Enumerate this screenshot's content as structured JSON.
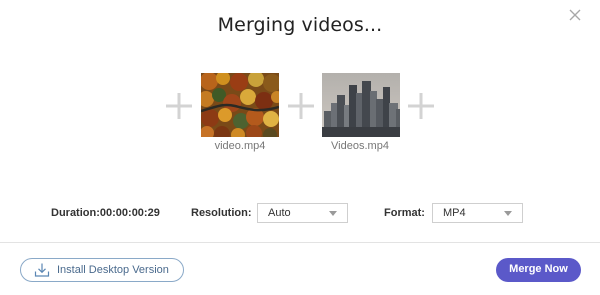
{
  "dialog": {
    "title": "Merging videos...",
    "close_icon": "close-icon"
  },
  "videos": [
    {
      "filename": "video.mp4",
      "thumbnail": "autumn-forest-aerial"
    },
    {
      "filename": "Videos.mp4",
      "thumbnail": "city-skyline"
    }
  ],
  "add_icon": "plus-icon",
  "options": {
    "duration_label": "Duration:",
    "duration_value": "00:00:00:29",
    "resolution_label": "Resolution:",
    "resolution_value": "Auto",
    "format_label": "Format:",
    "format_value": "MP4"
  },
  "footer": {
    "install_label": "Install Desktop Version",
    "install_icon": "download-icon",
    "merge_label": "Merge Now"
  },
  "colors": {
    "accent": "#5b59c9",
    "install_border": "#8aa9c8",
    "install_text": "#4a6a8d"
  }
}
